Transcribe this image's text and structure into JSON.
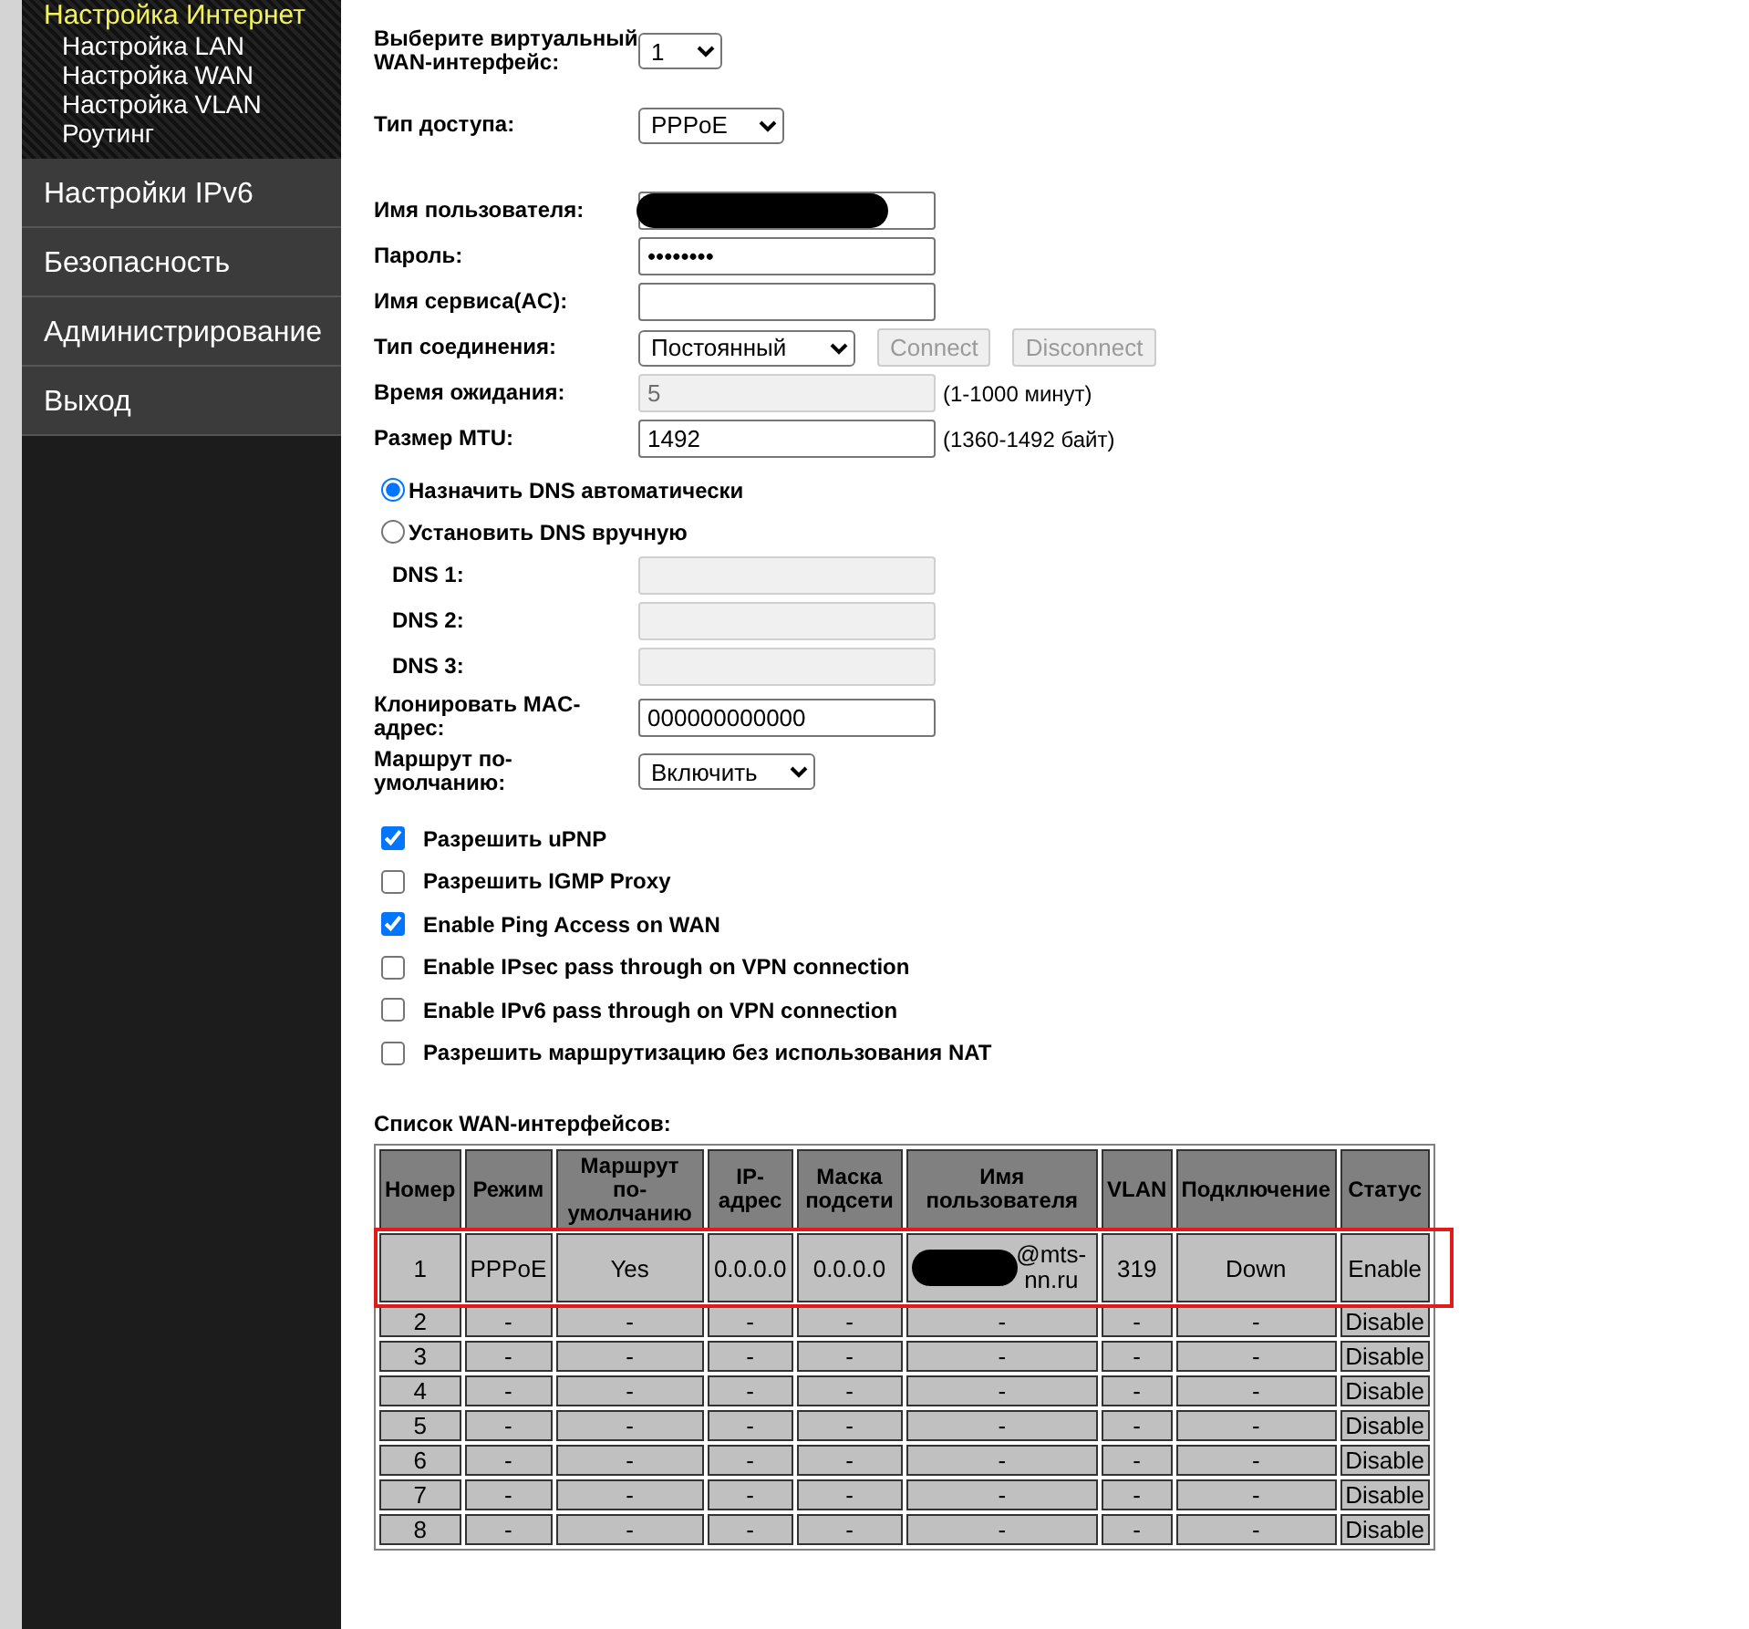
{
  "sidebar": {
    "section_title": "Настройка Интернет",
    "sub_items": [
      "Настройка LAN",
      "Настройка WAN",
      "Настройка VLAN",
      "Роутинг"
    ],
    "items": [
      "Настройки IPv6",
      "Безопасность",
      "Администрирование",
      "Выход"
    ]
  },
  "form": {
    "rows": [
      {
        "kind": "select",
        "label": "Выберите виртуальный WAN-интерфейс:",
        "value": "1"
      },
      {
        "kind": "select",
        "label": "Тип доступа:",
        "value": "PPPoE"
      },
      {
        "kind": "redacted",
        "label": "Имя пользователя:"
      },
      {
        "kind": "text",
        "label": "Пароль:",
        "value": "••••••••"
      },
      {
        "kind": "text",
        "label": "Имя сервиса(AC):"
      },
      {
        "kind": "connection",
        "label": "Тип соединения:",
        "value": "Постоянный",
        "buttons": [
          {
            "label": "Connect",
            "disabled": true
          },
          {
            "label": "Disconnect",
            "disabled": true
          }
        ]
      },
      {
        "kind": "text",
        "label": "Время ожидания:",
        "value": "5",
        "disabled": true,
        "hint": "(1-1000 минут)"
      },
      {
        "kind": "text",
        "label": "Размер MTU:",
        "value": "1492",
        "disabled": false,
        "hint": "(1360-1492 байт)"
      }
    ],
    "dns_modes": [
      {
        "label": "Назначить DNS автоматически",
        "selected": true
      },
      {
        "label": "Установить DNS вручную",
        "selected": false
      }
    ],
    "dns_fields": [
      {
        "label": "DNS 1:",
        "disabled": true
      },
      {
        "label": "DNS 2:",
        "disabled": true
      },
      {
        "label": "DNS 3:",
        "disabled": true
      }
    ],
    "rows2": [
      {
        "kind": "text",
        "label": "Клонировать MAC-адрес:",
        "value": "000000000000"
      },
      {
        "kind": "select",
        "label": "Маршрут по-умолчанию:",
        "value": "Включить"
      }
    ],
    "checkboxes": [
      {
        "label": "Разрешить uPNP",
        "checked": true
      },
      {
        "label": "Разрешить IGMP Proxy",
        "checked": false
      },
      {
        "label": "Enable Ping Access on WAN",
        "checked": true
      },
      {
        "label": "Enable IPsec pass through on VPN connection",
        "checked": false
      },
      {
        "label": "Enable IPv6 pass through on VPN connection",
        "checked": false
      },
      {
        "label": "Разрешить маршрутизацию без использования NAT",
        "checked": false
      }
    ]
  },
  "table": {
    "title": "Список WAN-интерфейсов:",
    "columns": [
      "Номер",
      "Режим",
      "Маршрут по-умолчанию",
      "IP-адрес",
      "Маска подсети",
      "Имя пользователя",
      "VLAN",
      "Подключение",
      "Статус"
    ],
    "rows": [
      {
        "cells": [
          "1",
          "PPPoE",
          "Yes",
          "0.0.0.0",
          "0.0.0.0",
          "@mts-nn.ru",
          "319",
          "Down",
          "Enable"
        ],
        "highlighted": true,
        "user_redacted": true
      },
      {
        "cells": [
          "2",
          "-",
          "-",
          "-",
          "-",
          "-",
          "-",
          "-",
          "Disable"
        ],
        "highlighted": false
      },
      {
        "cells": [
          "3",
          "-",
          "-",
          "-",
          "-",
          "-",
          "-",
          "-",
          "Disable"
        ],
        "highlighted": false
      },
      {
        "cells": [
          "4",
          "-",
          "-",
          "-",
          "-",
          "-",
          "-",
          "-",
          "Disable"
        ],
        "highlighted": false
      },
      {
        "cells": [
          "5",
          "-",
          "-",
          "-",
          "-",
          "-",
          "-",
          "-",
          "Disable"
        ],
        "highlighted": false
      },
      {
        "cells": [
          "6",
          "-",
          "-",
          "-",
          "-",
          "-",
          "-",
          "-",
          "Disable"
        ],
        "highlighted": false
      },
      {
        "cells": [
          "7",
          "-",
          "-",
          "-",
          "-",
          "-",
          "-",
          "-",
          "Disable"
        ],
        "highlighted": false
      },
      {
        "cells": [
          "8",
          "-",
          "-",
          "-",
          "-",
          "-",
          "-",
          "-",
          "Disable"
        ],
        "highlighted": false
      }
    ]
  }
}
